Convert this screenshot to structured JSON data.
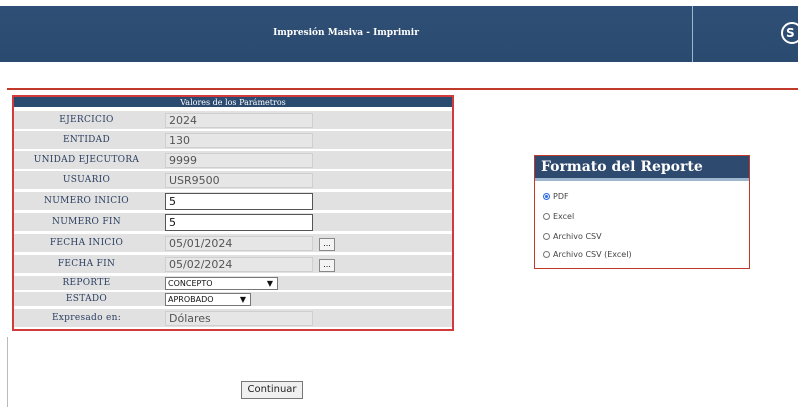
{
  "header": {
    "title": "Impresión Masiva - Imprimir"
  },
  "params": {
    "heading": "Valores de los Parámetros",
    "rows": [
      {
        "label": "EJERCICIO",
        "value": "2024"
      },
      {
        "label": "ENTIDAD",
        "value": "130"
      },
      {
        "label": "UNIDAD EJECUTORA",
        "value": "9999"
      },
      {
        "label": "USUARIO",
        "value": "USR9500"
      },
      {
        "label": "NUMERO INICIO",
        "value": "5"
      },
      {
        "label": "NUMERO FIN",
        "value": "5"
      },
      {
        "label": "FECHA INICIO",
        "value": "05/01/2024",
        "button": "..."
      },
      {
        "label": "FECHA FIN",
        "value": "05/02/2024",
        "button": "..."
      },
      {
        "label": "REPORTE",
        "value": "CONCEPTO"
      },
      {
        "label": "ESTADO",
        "value": "APROBADO"
      },
      {
        "label": "Expresado en:",
        "value": "Dólares"
      }
    ]
  },
  "format": {
    "title": "Formato del Reporte",
    "options": [
      "PDF",
      "Excel",
      "Archivo CSV",
      "Archivo CSV (Excel)"
    ],
    "selected": "PDF"
  },
  "actions": {
    "continue_label": "Continuar"
  }
}
